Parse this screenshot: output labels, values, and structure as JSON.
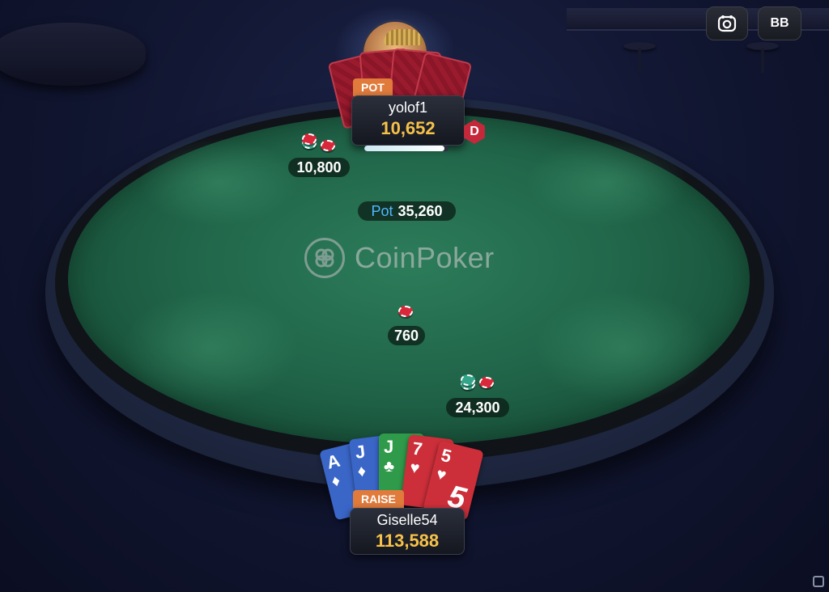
{
  "table": {
    "logo_text": "CoinPoker",
    "pot_label": "Pot",
    "pot_amount": "35,260"
  },
  "opponent": {
    "name": "yolof1",
    "stack": "10,652",
    "action": "POT",
    "bet": "10,800",
    "dealer_label": "D",
    "timer_remaining": 0.95
  },
  "hero": {
    "name": "Giselle54",
    "stack": "113,588",
    "action": "RAISE",
    "bet": "24,300",
    "cards": [
      {
        "rank": "A",
        "suit": "♦",
        "color": "#3a66c8"
      },
      {
        "rank": "J",
        "suit": "♦",
        "color": "#3a66c8"
      },
      {
        "rank": "J",
        "suit": "♣",
        "color": "#2f9a4a"
      },
      {
        "rank": "7",
        "suit": "♥",
        "color": "#cc2f3a"
      },
      {
        "rank": "5",
        "suit": "♥",
        "color": "#cc2f3a"
      }
    ],
    "big_rank": "5"
  },
  "center_bet": "760",
  "hud": {
    "bb_label": "BB",
    "camera_icon": "chip-camera-icon"
  }
}
